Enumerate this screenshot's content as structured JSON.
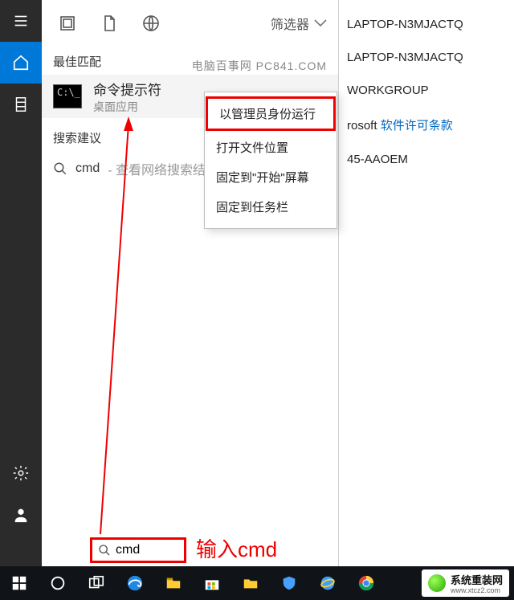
{
  "panel": {
    "filter_label": "筛选器",
    "section_best": "最佳匹配",
    "best_match": {
      "title": "命令提示符",
      "subtitle": "桌面应用",
      "icon_text": "C:\\_"
    },
    "watermark": "电脑百事网 PC841.COM",
    "section_sugg": "搜索建议",
    "suggestion": {
      "term": "cmd",
      "tail": " - 查看网络搜索结果"
    }
  },
  "context_menu": {
    "items": [
      "以管理员身份运行",
      "打开文件位置",
      "固定到\"开始\"屏幕",
      "固定到任务栏"
    ]
  },
  "annotation": {
    "input_hint": "输入cmd"
  },
  "search_value": "cmd",
  "background": {
    "row1": "LAPTOP-N3MJACTQ",
    "row2": "LAPTOP-N3MJACTQ",
    "row3": "WORKGROUP",
    "row4_prefix": "rosoft ",
    "row4_link": "软件许可条款",
    "row5": "45-AAOEM"
  },
  "brand": {
    "cn": "系统重装网",
    "en": "www.xtcz2.com"
  }
}
